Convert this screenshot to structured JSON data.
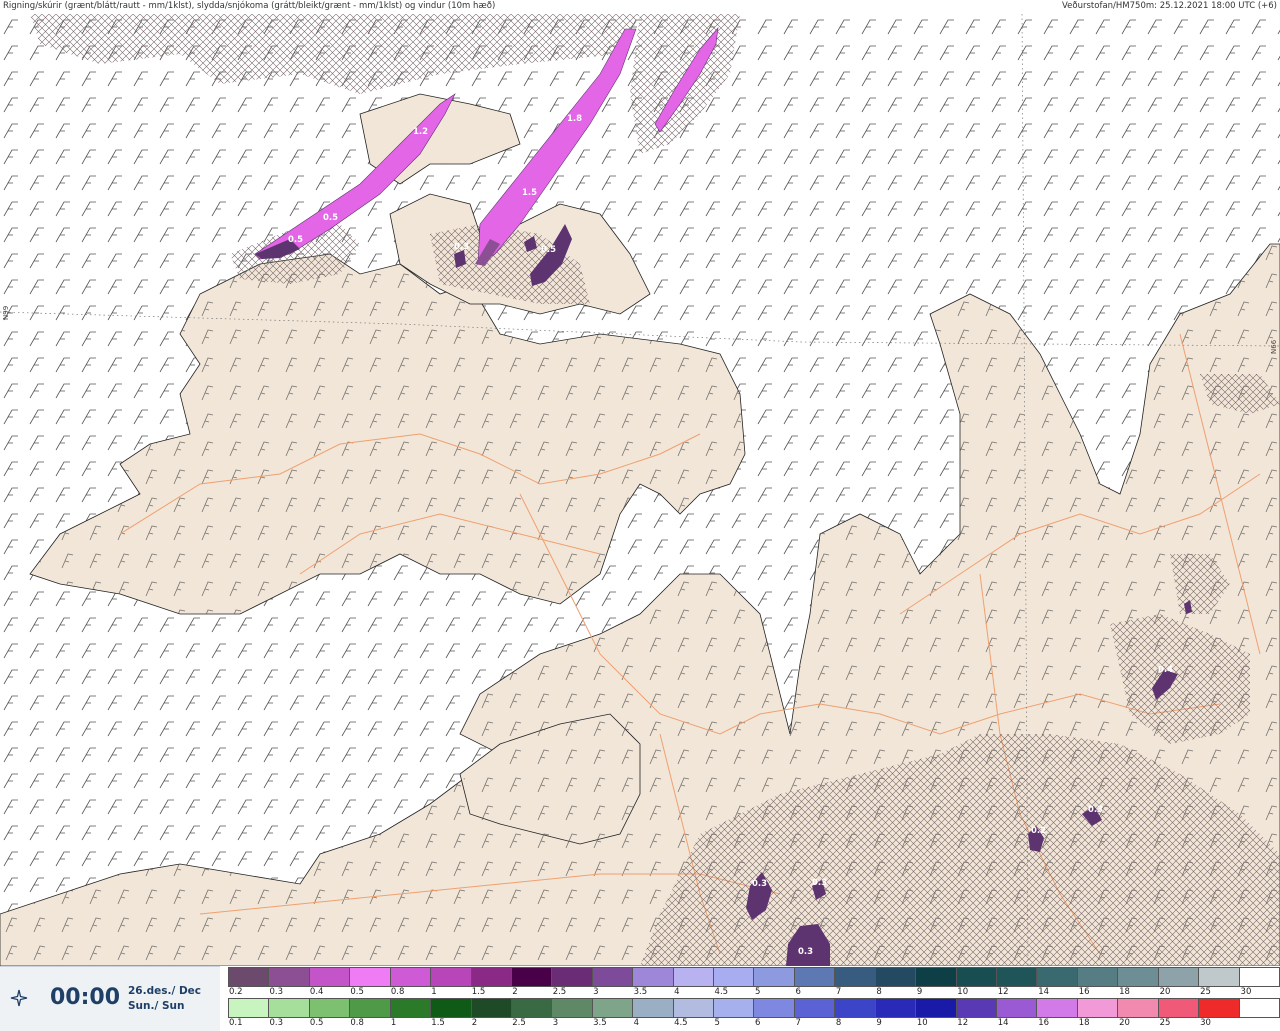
{
  "header": {
    "left_title": "Rigning/skúrir (grænt/blátt/rautt - mm/1klst), slydda/snjókoma (grátt/bleikt/grænt - mm/1klst) og vindur (10m hæð)",
    "right_title": "Veðurstofan/HM750m: 25.12.2021 18:00 UTC (+6)"
  },
  "map": {
    "lat_label_left": "N99",
    "lat_label_right": "N66",
    "colors": {
      "land": "#f2e6d8",
      "sea": "#ffffff",
      "roads": "#f0a070",
      "coast": "#222222",
      "snow_light": "#e266e6",
      "snow_dark": "#5e3470"
    },
    "precip_labels": [
      "1.2",
      "1.8",
      "1.5",
      "0.5",
      "0.5",
      "0.3",
      "0.5",
      "0.4",
      "0.3",
      "0.2",
      "0.3",
      "0.3",
      "0.3"
    ]
  },
  "time_panel": {
    "icon": "wind-direction-icon",
    "time": "00:00",
    "date_line1": "26.des./ Dec",
    "date_line2": "Sun./ Sun"
  },
  "legend_snow": {
    "labels": [
      "0.2",
      "0.3",
      "0.4",
      "0.5",
      "0.8",
      "1",
      "1.5",
      "2",
      "2.5",
      "3",
      "3.5",
      "4",
      "4.5",
      "5",
      "6",
      "7",
      "8",
      "9",
      "10",
      "12",
      "14",
      "16",
      "18",
      "20",
      "25",
      "30"
    ],
    "colors": [
      "#6b4a6e",
      "#8c4f94",
      "#c455c9",
      "#f07cf5",
      "#cf5ad6",
      "#b946b8",
      "#8a2a86",
      "#4a0048",
      "#6a2c74",
      "#7e4a9a",
      "#9e86d8",
      "#b9b2f0",
      "#a8acf0",
      "#8d9ae0",
      "#5e78b4",
      "#385c80",
      "#234a60",
      "#0e3f46",
      "#184e52",
      "#1f5558",
      "#3a6a70",
      "#567c84",
      "#6e8e96",
      "#8ea2aa",
      "#bfc9cc",
      "#ffffff"
    ]
  },
  "legend_rain": {
    "labels": [
      "0.1",
      "0.3",
      "0.5",
      "0.8",
      "1",
      "1.5",
      "2",
      "2.5",
      "3",
      "3.5",
      "4",
      "4.5",
      "5",
      "6",
      "7",
      "8",
      "9",
      "10",
      "12",
      "14",
      "16",
      "18",
      "20",
      "25",
      "30"
    ],
    "colors": [
      "#c8f4c0",
      "#a6de9c",
      "#7cc070",
      "#4e9a46",
      "#2a7a2a",
      "#0e5a16",
      "#1e4a28",
      "#3a6a44",
      "#5e8866",
      "#7ea48a",
      "#9aaec4",
      "#b2bce0",
      "#a6b0ec",
      "#7e88e0",
      "#5a62d4",
      "#3c44c8",
      "#2a2ab8",
      "#1a1aa8",
      "#5a3ab4",
      "#9a5ad4",
      "#d27ae8",
      "#f29ad8",
      "#f28ab0",
      "#f05a78",
      "#ee2a2a",
      "#ffffff"
    ]
  }
}
